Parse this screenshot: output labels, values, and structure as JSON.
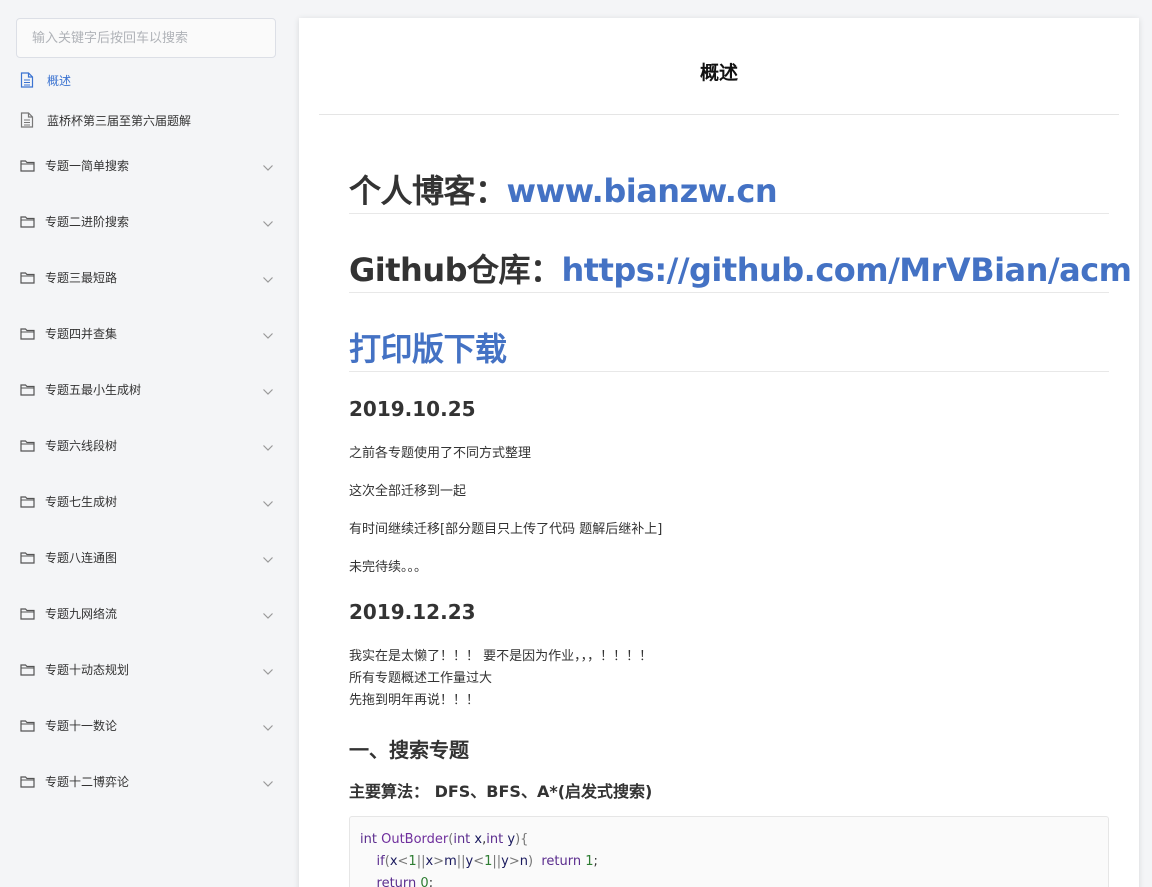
{
  "sidebar": {
    "search_placeholder": "输入关键字后按回车以搜索",
    "docs": [
      {
        "label": "概述",
        "active": true
      },
      {
        "label": "蓝桥杯第三届至第六届题解",
        "active": false
      }
    ],
    "folders": [
      "专题一简单搜索",
      "专题二进阶搜索",
      "专题三最短路",
      "专题四并查集",
      "专题五最小生成树",
      "专题六线段树",
      "专题七生成树",
      "专题八连通图",
      "专题九网络流",
      "专题十动态规划",
      "专题十一数论",
      "专题十二博弈论"
    ]
  },
  "main": {
    "title": "概述",
    "blog_prefix": "个人博客：",
    "blog_link": "www.bianzw.cn",
    "github_prefix": "Github仓库：",
    "github_link": "https://github.com/MrVBian/acm",
    "download_link": "打印版下载",
    "date1": "2019.10.25",
    "p1": "之前各专题使用了不同方式整理",
    "p2": "这次全部迁移到一起",
    "p3": "有时间继续迁移[部分题目只上传了代码 题解后继补上]",
    "p4": "未完待续。。。",
    "date2": "2019.12.23",
    "p5": "我实在是太懒了！！！ 要不是因为作业，，，！！！！",
    "p6": "所有专题概述工作量过大",
    "p7": "先拖到明年再说！！！",
    "section1": "一、搜索专题",
    "algo": "主要算法： DFS、BFS、A*(启发式搜索)"
  },
  "colors": {
    "accent": "#3b73d1",
    "link": "#4472c4"
  }
}
